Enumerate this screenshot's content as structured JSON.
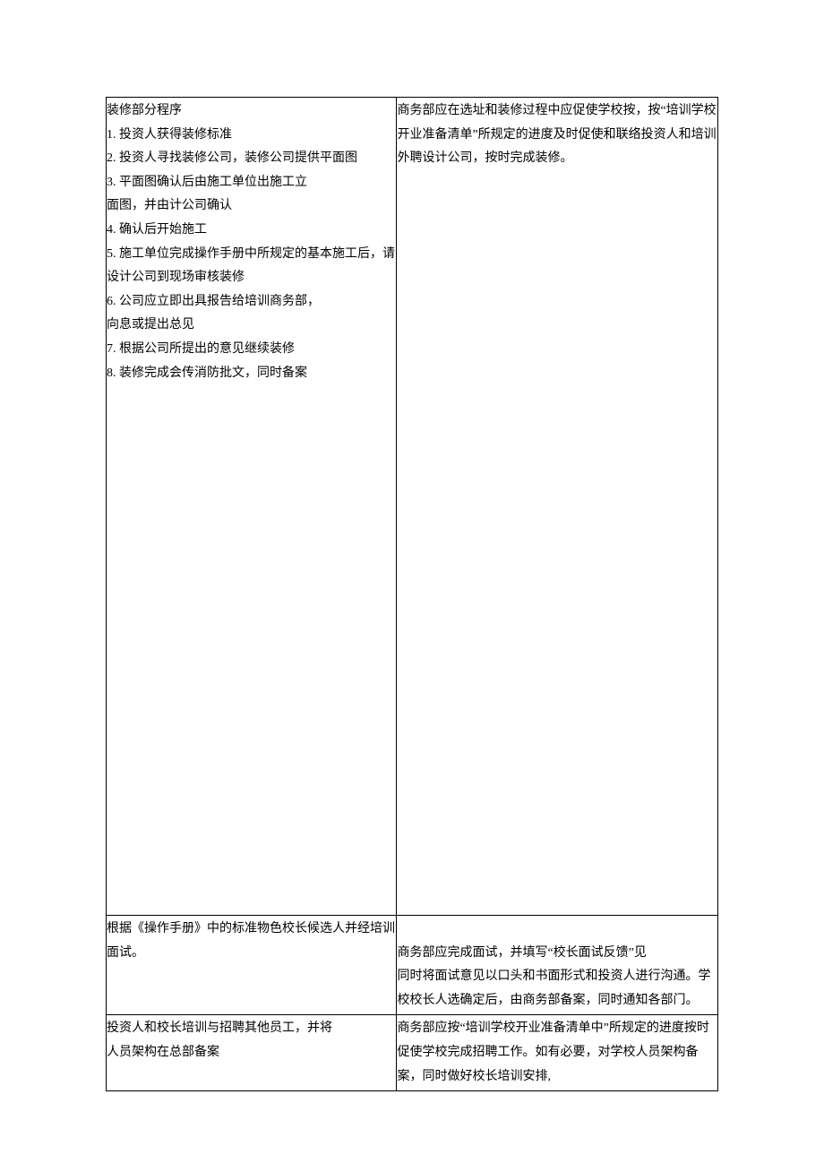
{
  "rows": [
    {
      "left": "装修部分程序\n1. 投资人获得装修标准\n2. 投资人寻找装修公司，装修公司提供平面图\n3. 平面图确认后由施工单位出施工立\n面图，并由计公司确认\n4. 确认后开始施工\n5. 施工单位完成操作手册中所规定的基本施工后，请设计公司到现场审核装修\n6. 公司应立即出具报告给培训商务部，\n向息或提出总见\n7. 根据公司所提出的意见继续装修\n8. 装修完成会传消防批文，同时备案",
      "right": "商务部应在选址和装修过程中应促使学校按，按“培训学校开业准备清单”所规定的进度及时促使和联络投资人和培训外聘设计公司，按时完成装修。"
    },
    {
      "left": "根据《操作手册》中的标准物色校长候选人并经培训面试。",
      "right": "\n商务部应完成面试，并填写“校长面试反馈”见\n同时将面试意见以口头和书面形式和投资人进行沟通。学校校长人选确定后，由商务部备案，同时通知各部门。"
    },
    {
      "left": "投资人和校长培训与招聘其他员工，并将\n人员架构在总部备案",
      "right": "商务部应按“培训学校开业准备清单中”所规定的进度按时促使学校完成招聘工作。如有必要，对学校人员架构备案，同时做好校长培训安排,"
    }
  ]
}
